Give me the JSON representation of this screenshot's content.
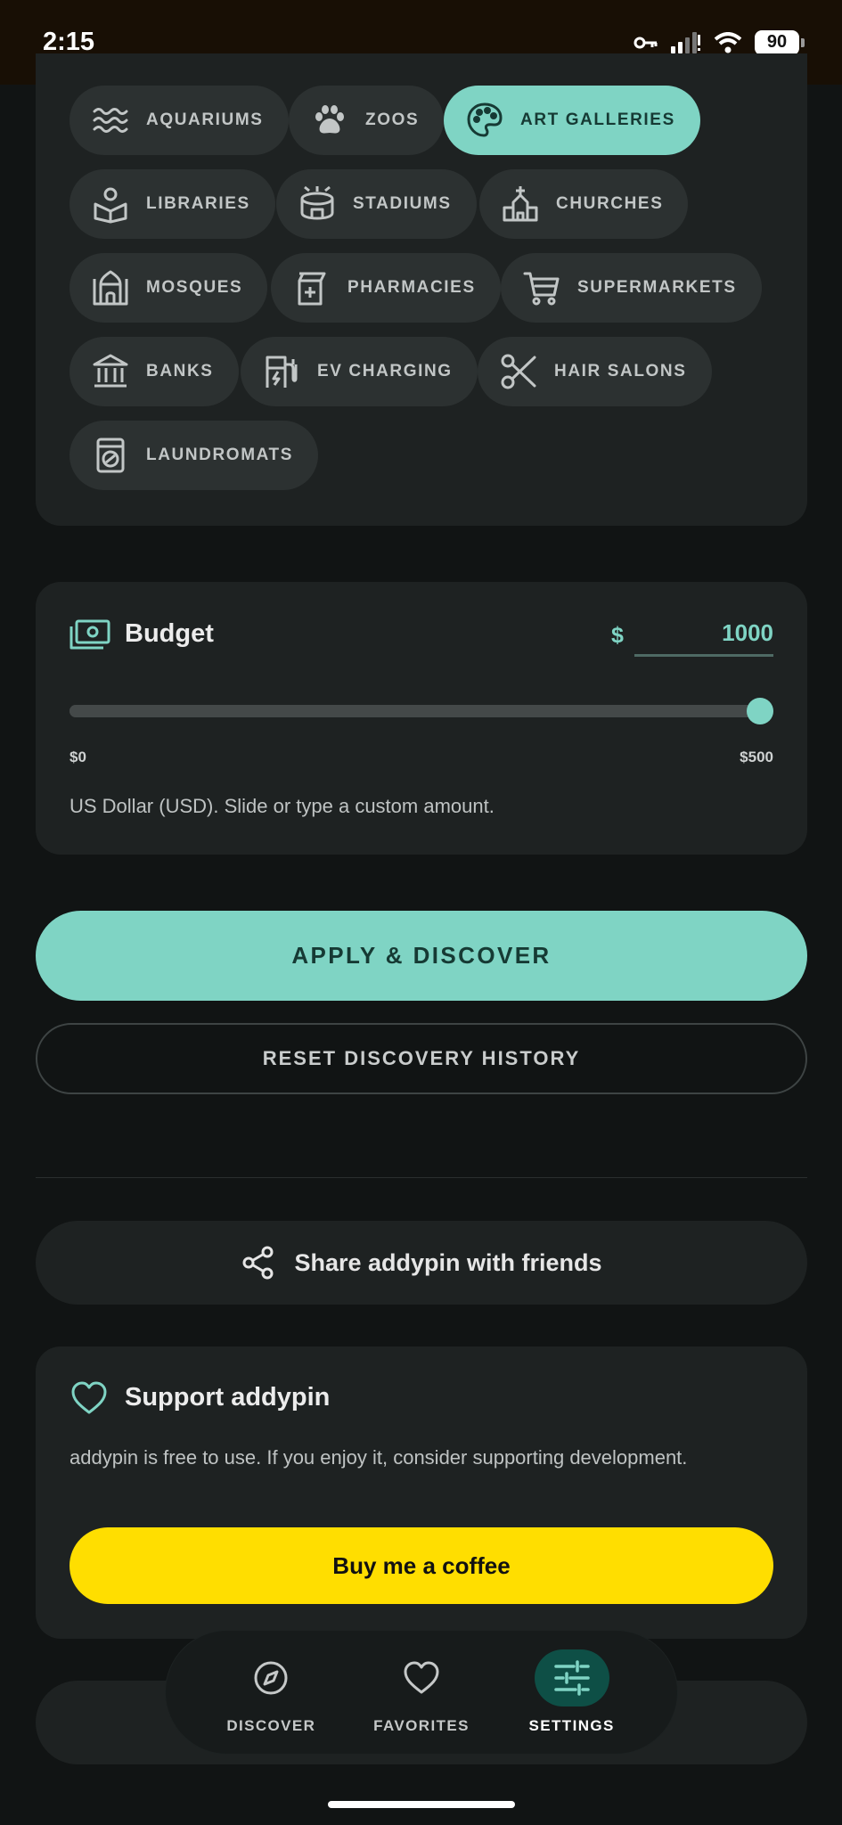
{
  "status_bar": {
    "time": "2:15",
    "battery": "90"
  },
  "categories": [
    {
      "label": "AQUARIUMS",
      "icon": "waves-icon"
    },
    {
      "label": "ZOOS",
      "icon": "paw-icon"
    },
    {
      "label": "ART GALLERIES",
      "icon": "palette-icon",
      "selected": true
    },
    {
      "label": "LIBRARIES",
      "icon": "library-icon"
    },
    {
      "label": "STADIUMS",
      "icon": "stadium-icon"
    },
    {
      "label": "CHURCHES",
      "icon": "church-icon"
    },
    {
      "label": "MOSQUES",
      "icon": "mosque-icon"
    },
    {
      "label": "PHARMACIES",
      "icon": "pharmacy-icon"
    },
    {
      "label": "SUPERMARKETS",
      "icon": "cart-icon"
    },
    {
      "label": "BANKS",
      "icon": "bank-icon"
    },
    {
      "label": "EV CHARGING",
      "icon": "ev-charging-icon"
    },
    {
      "label": "HAIR SALONS",
      "icon": "scissors-icon"
    },
    {
      "label": "LAUNDROMATS",
      "icon": "washing-machine-icon"
    }
  ],
  "budget": {
    "title": "Budget",
    "currency_symbol": "$",
    "value": "1000",
    "slider_min_label": "$0",
    "slider_max_label": "$500",
    "slider_level": 1.0,
    "hint": "US Dollar (USD). Slide or type a custom amount."
  },
  "actions": {
    "apply_label": "APPLY & DISCOVER",
    "reset_label": "RESET DISCOVERY HISTORY"
  },
  "share": {
    "label": "Share addypin with friends"
  },
  "support": {
    "title": "Support addypin",
    "text": "addypin is free to use. If you enjoy it, consider supporting development.",
    "button_label": "Buy me a coffee"
  },
  "nav": [
    {
      "label": "DISCOVER",
      "icon": "compass-icon"
    },
    {
      "label": "FAVORITES",
      "icon": "heart-icon"
    },
    {
      "label": "SETTINGS",
      "icon": "sliders-icon",
      "active": true
    }
  ],
  "colors": {
    "accent": "#7fd4c4",
    "coffee": "#ffde00",
    "background": "#111414",
    "card": "#1e2222"
  }
}
